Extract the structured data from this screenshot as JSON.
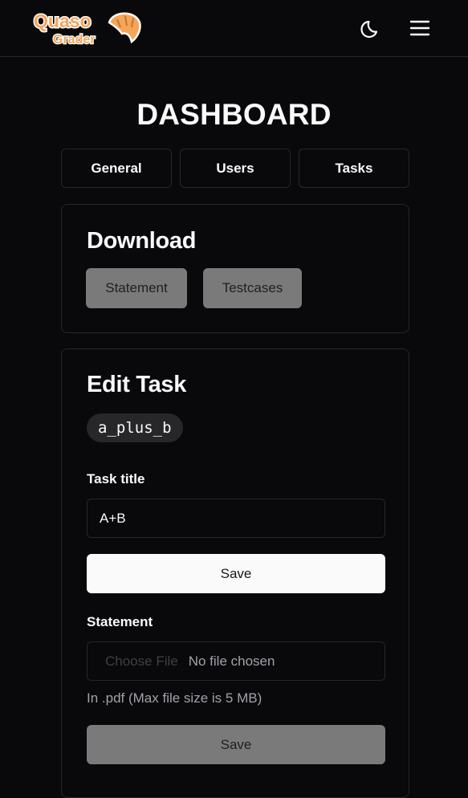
{
  "navbar": {
    "logo": {
      "line1": "Quaso",
      "line2": "Grader",
      "icon": "croissant-icon",
      "color": "#f5a55a"
    },
    "theme_icon": "moon-icon",
    "menu_icon": "hamburger-menu-icon"
  },
  "page": {
    "title": "DASHBOARD"
  },
  "tabs": [
    {
      "label": "General"
    },
    {
      "label": "Users"
    },
    {
      "label": "Tasks"
    }
  ],
  "download": {
    "title": "Download",
    "buttons": [
      {
        "label": "Statement"
      },
      {
        "label": "Testcases"
      }
    ]
  },
  "edit_task": {
    "title": "Edit Task",
    "task_id": "a_plus_b",
    "title_field": {
      "label": "Task title",
      "value": "A+B"
    },
    "save_title_label": "Save",
    "statement": {
      "label": "Statement",
      "choose_label": "Choose File",
      "file_status": "No file chosen",
      "hint": "In .pdf (Max file size is 5 MB)",
      "save_label": "Save"
    }
  },
  "colors": {
    "background": "#09090b",
    "border": "#27272a",
    "text": "#fafafa",
    "muted": "#a1a1aa",
    "disabled_button": "#7a7a7a",
    "logo_orange": "#f5a55a"
  }
}
